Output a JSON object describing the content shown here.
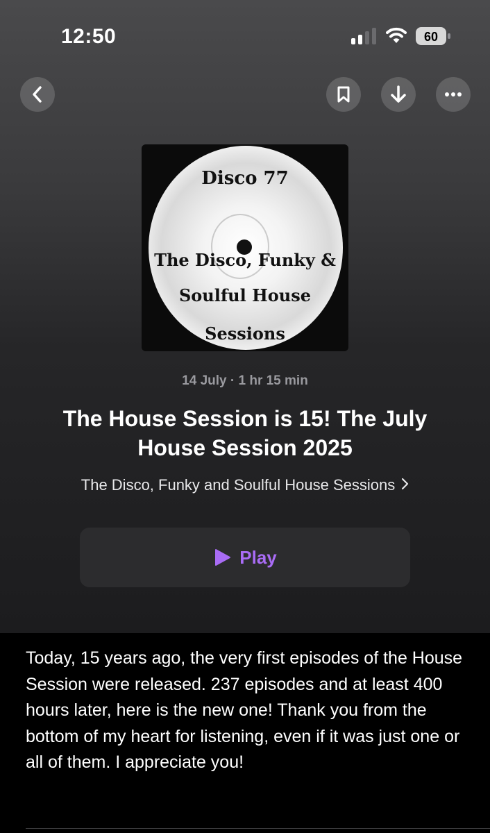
{
  "status_bar": {
    "time": "12:50",
    "battery_level": "60",
    "signal_icon": "cellular-signal-icon",
    "wifi_icon": "wifi-icon",
    "battery_icon": "battery-icon"
  },
  "toolbar": {
    "back_icon": "chevron-left-icon",
    "bookmark_icon": "bookmark-icon",
    "download_icon": "arrow-down-icon",
    "more_icon": "ellipsis-icon"
  },
  "artwork": {
    "line1": "Disco 77",
    "line2": "The Disco, Funky &",
    "line3": "Soulful House",
    "line4": "Sessions"
  },
  "episode": {
    "meta": "14 July · 1 hr 15 min",
    "title": "The House Session is 15! The July House Session 2025",
    "show_name": "The Disco, Funky and Soulful House Sessions",
    "play_label": "Play",
    "description": "Today, 15 years ago, the very first episodes of the House Session were released. 237 episodes and at least 400 hours later, here is the new one! Thank you from the bottom of my heart for listening, even if it was just one or all of them. I appreciate you!"
  },
  "colors": {
    "accent": "#a96cf5",
    "button_bg": "#2c2c2e",
    "background": "#000000"
  }
}
